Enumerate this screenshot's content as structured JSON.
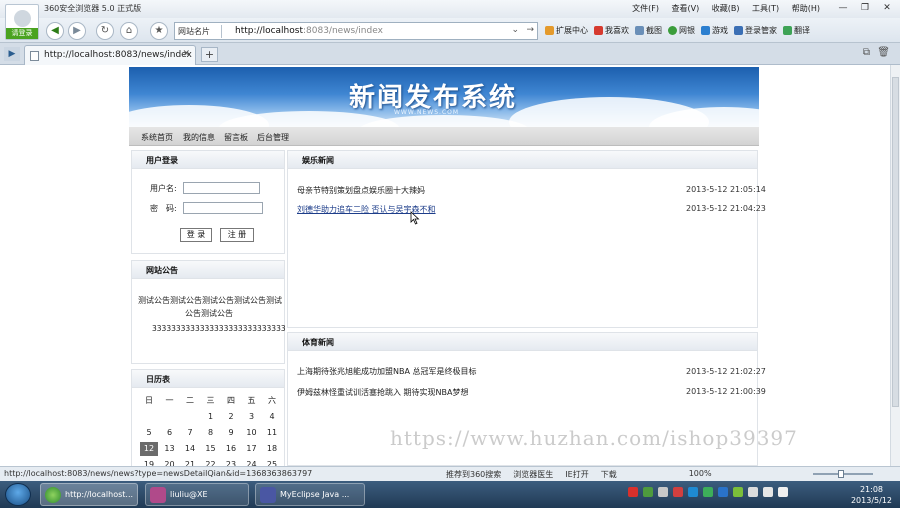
{
  "browser": {
    "title": "360安全浏览器 5.0 正式版",
    "menu": [
      "文件(F)",
      "查看(V)",
      "收藏(B)",
      "工具(T)",
      "帮助(H)"
    ],
    "login_label": "请登录",
    "address": {
      "favorites_label": "网站名片",
      "url_host": "http://localhost",
      "url_rest": ":8083/news/index"
    },
    "toolbar_items": [
      "扩展中心",
      "我喜欢",
      "截图",
      "网银",
      "游戏",
      "登录管家",
      "翻译"
    ],
    "tab": {
      "label": "http://localhost:8083/news/index"
    },
    "status_url": "http://localhost:8083/news/news?type=newsDetailQian&id=1368363863797",
    "status_items": [
      "推荐到360搜索",
      "浏览器医生",
      "IE打开",
      "下载"
    ],
    "zoom": "100%"
  },
  "site": {
    "banner_title": "新闻发布系统",
    "banner_sub": "WWW.NEWS.COM",
    "nav": [
      "系统首页",
      "我的信息",
      "留言板",
      "后台管理"
    ]
  },
  "login_panel": {
    "heading": "用户登录",
    "username_label": "用户名:",
    "password_label": "密　码:",
    "login_button": "登 录",
    "register_button": "注 册"
  },
  "notice_panel": {
    "heading": "网站公告",
    "line1": "测试公告测试公告测试公告测试公告测试",
    "line2": "公告测试公告",
    "line3": "3333333333333333333333333333"
  },
  "calendar": {
    "heading": "日历表",
    "weekdays": [
      "日",
      "一",
      "二",
      "三",
      "四",
      "五",
      "六"
    ],
    "row1": [
      "",
      "",
      "",
      "1",
      "2",
      "3",
      "4"
    ],
    "row2": [
      "5",
      "6",
      "7",
      "8",
      "9",
      "10",
      "11"
    ],
    "row3": [
      "12",
      "13",
      "14",
      "15",
      "16",
      "17",
      "18"
    ],
    "row4": [
      "19",
      "20",
      "21",
      "22",
      "23",
      "24",
      "25"
    ],
    "today": "12"
  },
  "entertainment": {
    "heading": "娱乐新闻",
    "items": [
      {
        "title": "母亲节特别策划盘点娱乐圈十大辣妈",
        "time": "2013-5-12 21:05:14"
      },
      {
        "title": "刘德华助力追车二险 否认与吴宇森不和",
        "time": "2013-5-12 21:04:23"
      }
    ]
  },
  "sports": {
    "heading": "体育新闻",
    "items": [
      {
        "title": "上海期待张兆旭能成功加盟NBA 总冠军是终极目标",
        "time": "2013-5-12 21:02:27"
      },
      {
        "title": "伊姆兹林怪重试训活塞抢跳入 期待实现NBA梦想",
        "time": "2013-5-12 21:00:39"
      }
    ]
  },
  "watermark": "https://www.huzhan.com/ishop39397",
  "taskbar": {
    "tasks": [
      "http://localhost...",
      "liuliu@XE",
      "MyEclipse Java ..."
    ],
    "time": "21:08",
    "date": "2013/5/12"
  }
}
